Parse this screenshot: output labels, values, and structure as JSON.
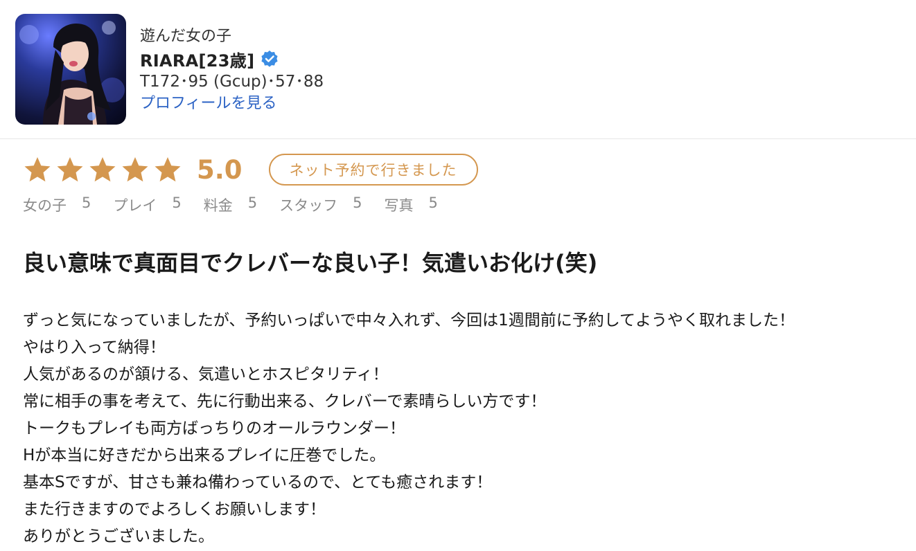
{
  "header": {
    "played_label": "遊んだ女の子",
    "name": "RIARA[23歳]",
    "stats": "T172･95 (Gcup)･57･88",
    "profile_link": "プロフィールを見る",
    "avatar_icon": "profile-photo",
    "verified_icon": "verified-badge-icon"
  },
  "rating": {
    "stars": 5,
    "score": "5.0",
    "pill": "ネット予約で行きました",
    "star_color": "#d4974f"
  },
  "sub_ratings": [
    {
      "label": "女の子",
      "value": "5"
    },
    {
      "label": "プレイ",
      "value": "5"
    },
    {
      "label": "料金",
      "value": "5"
    },
    {
      "label": "スタッフ",
      "value": "5"
    },
    {
      "label": "写真",
      "value": "5"
    }
  ],
  "review": {
    "title": "良い意味で真面目でクレバーな良い子！気遣いお化け(笑)",
    "lines": [
      "ずっと気になっていましたが、予約いっぱいで中々入れず、今回は1週間前に予約してようやく取れました！",
      "やはり入って納得！",
      "人気があるのが頷ける、気遣いとホスピタリティ！",
      "常に相手の事を考えて、先に行動出来る、クレバーで素晴らしい方です！",
      "トークもプレイも両方ばっちりのオールラウンダー！",
      "Hが本当に好きだから出来るプレイに圧巻でした。",
      "基本Sですが、甘さも兼ね備わっているので、とても癒されます！",
      "また行きますのでよろしくお願いします！",
      "ありがとうございました。"
    ]
  },
  "colors": {
    "accent": "#d4974f",
    "link": "#2b62c4",
    "verified": "#3b8de4"
  }
}
